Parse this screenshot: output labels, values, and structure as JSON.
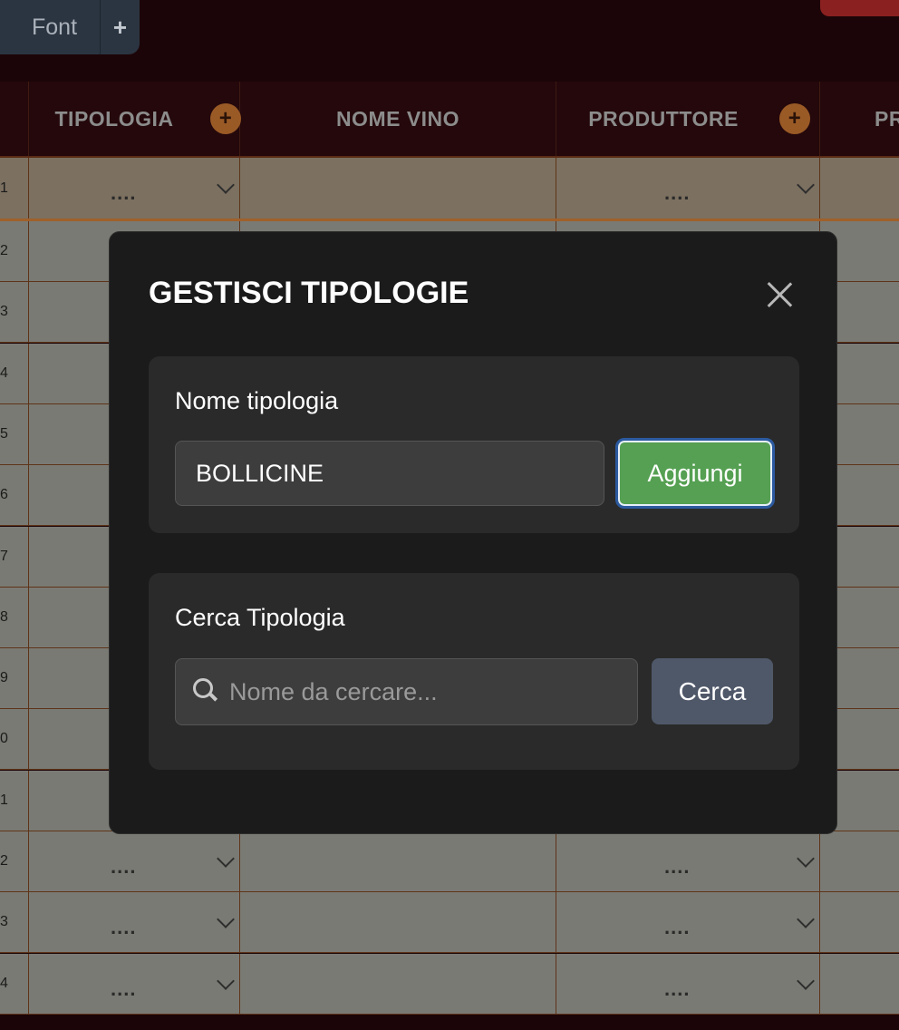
{
  "toolbar": {
    "font_label": "Font",
    "add_label": "+"
  },
  "table": {
    "headers": [
      {
        "label": "TIPOLOGIA",
        "add": "+"
      },
      {
        "label": "NOME VINO"
      },
      {
        "label": "PRODUTTORE",
        "add": "+"
      },
      {
        "label": "PR"
      }
    ],
    "rows": [
      {
        "num": "1",
        "tipologia": "....",
        "produttore": "...."
      },
      {
        "num": "2"
      },
      {
        "num": "3"
      },
      {
        "num": "4"
      },
      {
        "num": "5"
      },
      {
        "num": "6"
      },
      {
        "num": "7"
      },
      {
        "num": "8"
      },
      {
        "num": "9"
      },
      {
        "num": "0"
      },
      {
        "num": "1"
      },
      {
        "num": "2",
        "tipologia": "....",
        "produttore": "...."
      },
      {
        "num": "3",
        "tipologia": "....",
        "produttore": "...."
      },
      {
        "num": "4",
        "tipologia": "....",
        "produttore": "...."
      }
    ]
  },
  "modal": {
    "title": "GESTISCI TIPOLOGIE",
    "add_section": {
      "label": "Nome tipologia",
      "input_value": "BOLLICINE",
      "button_label": "Aggiungi"
    },
    "search_section": {
      "label": "Cerca Tipologia",
      "placeholder": "Nome da cercare...",
      "button_label": "Cerca"
    }
  },
  "colors": {
    "accent_green": "#55a052",
    "modal_bg": "#1b1b1b",
    "header_bg": "#24080b"
  }
}
